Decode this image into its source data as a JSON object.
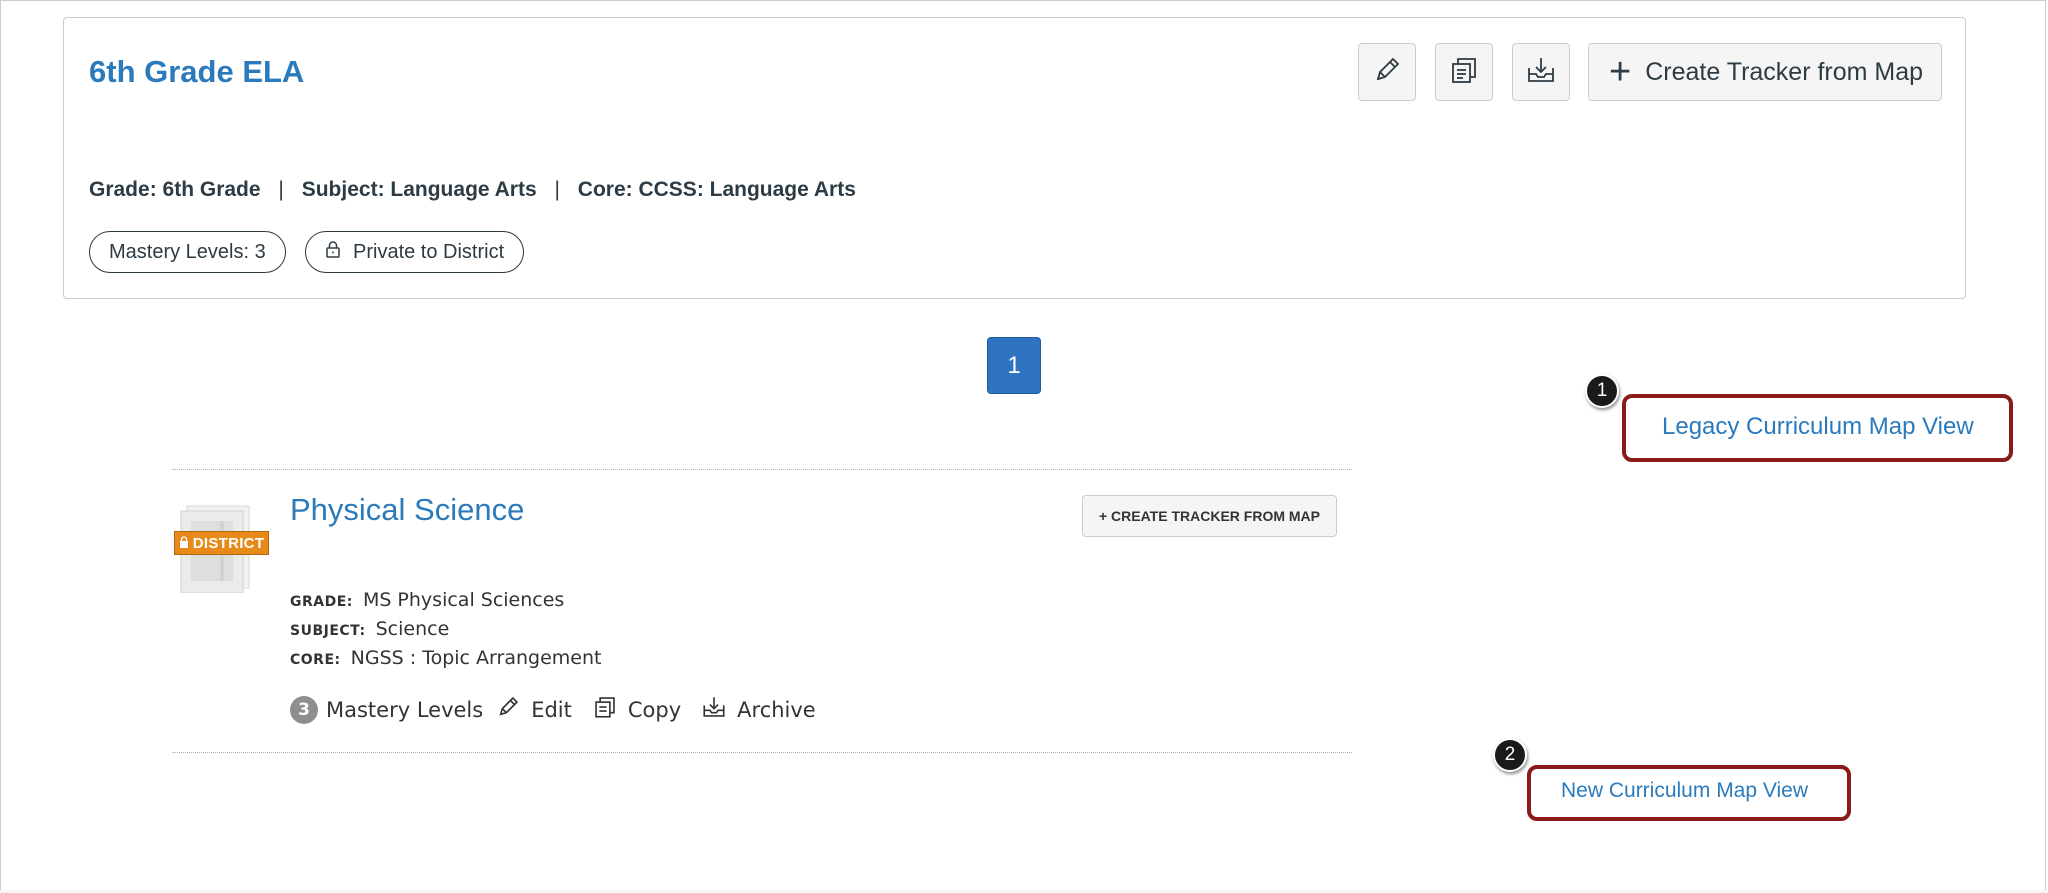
{
  "header": {
    "title": "6th Grade ELA",
    "create_label": "Create Tracker from Map",
    "grade": "Grade: 6th Grade",
    "subject": "Subject: Language Arts",
    "core": "Core: CCSS: Language Arts",
    "separator": "|",
    "mastery_pill": "Mastery Levels: 3",
    "private_pill": "Private to District",
    "icons": [
      "pencil-icon",
      "copy-icon",
      "archive-icon",
      "plus-icon",
      "lock-icon"
    ]
  },
  "pagination": {
    "current_page": "1"
  },
  "callouts": {
    "legacy": {
      "number": "1",
      "label": "Legacy Curriculum Map View"
    },
    "new": {
      "number": "2",
      "label": "New Curriculum Map View"
    }
  },
  "map_item": {
    "badge": "DISTRICT",
    "title": "Physical Science",
    "create_label": "+ CREATE TRACKER FROM MAP",
    "grade_label": "GRADE:",
    "grade_value": "MS Physical Sciences",
    "subject_label": "SUBJECT:",
    "subject_value": "Science",
    "core_label": "CORE:",
    "core_value": "NGSS : Topic Arrangement",
    "mastery_count": "3",
    "mastery_label": "Mastery Levels",
    "edit_label": "Edit",
    "copy_label": "Copy",
    "archive_label": "Archive"
  },
  "colors": {
    "link": "#2b7abc",
    "primary": "#2f74c0",
    "highlight_border": "#8b1a1a",
    "district_badge": "#e88a1a"
  }
}
